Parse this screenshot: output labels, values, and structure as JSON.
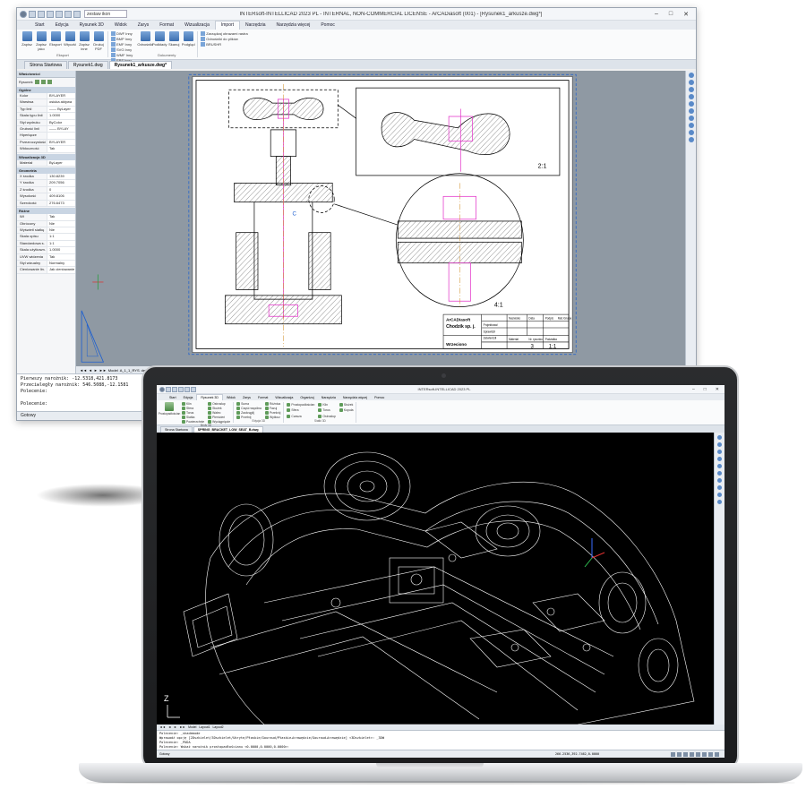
{
  "desktop": {
    "title": "INTERsoft-INTELLICAD 2023 PL - INTERNAL, NON-COMMERCIAL LICENSE - ArCADiasoft (001) - [Rysunek1_arkusze.dwg*]",
    "quick_select": "zestaw ikon",
    "window_controls": {
      "minimize": "–",
      "maximize": "□",
      "close": "✕"
    },
    "menu_tabs": [
      "Start",
      "Edycja",
      "Rysunek 3D",
      "Widok",
      "Zarys",
      "Format",
      "Wizualizacja",
      "Import",
      "Narzędzia",
      "Narzędzia więcej",
      "Pomoc"
    ],
    "active_tab": "Import",
    "ribbon": {
      "group1": {
        "label": "Eksport",
        "buttons": [
          "Zapisz",
          "Zapisz jako",
          "Eksport",
          "Wtyczki",
          "Zapisz inne",
          "Drukuj PDF"
        ],
        "small": [
          "DWF Inny",
          "BMP Inny",
          "EMF Inny",
          "SVG Inny",
          "WMF Inny",
          "EPS Inny"
        ]
      },
      "group2": {
        "label": "Dokumenty",
        "buttons": [
          "Odnośniki",
          "Podkłady",
          "Skanuj",
          "Podgląd"
        ],
        "small": [
          "Zarządzaj obrazami rastra",
          "Odnośniki do plików",
          "BRUSHR"
        ]
      }
    },
    "doc_tabs": [
      "Strona Startowa",
      "Rysunek1.dwg",
      "Rysunek1_arkusze.dwg*"
    ],
    "active_doc": "Rysunek1_arkusze.dwg*",
    "props": {
      "header": "Właściwości",
      "selection": "Rysunek",
      "sections": [
        {
          "title": "Ogólne",
          "rows": [
            [
              "Kolor",
              "BYLAYER"
            ],
            [
              "Warstwa",
              "osiuka aktywa"
            ],
            [
              "Typ linii",
              "—— ByLayer"
            ],
            [
              "Skala typu linii",
              "1.0000"
            ],
            [
              "Styl wydruku",
              "ByColor"
            ],
            [
              "Grubość linii",
              "—— BYLAY"
            ],
            [
              "Hiperłącze",
              ""
            ],
            [
              "Przezroczystość",
              "BYLAYER"
            ],
            [
              "Widoczność",
              "Tak"
            ]
          ]
        },
        {
          "title": "Wizualizacja 3D",
          "rows": [
            [
              "Materiał",
              "ByLayer"
            ]
          ]
        },
        {
          "title": "Geometria",
          "rows": [
            [
              "X środka",
              "130.8239"
            ],
            [
              "Y środka",
              "209.7056"
            ],
            [
              "Z środka",
              "0"
            ],
            [
              "Wysokość",
              "409.8106"
            ],
            [
              "Szerokość",
              "276.6473"
            ]
          ]
        },
        {
          "title": "Różne",
          "rows": [
            [
              "Wł",
              "Tak"
            ],
            [
              "Obrócony",
              "Nie"
            ],
            [
              "Wyświetl siatkę",
              "Nie"
            ],
            [
              "Skala opisu",
              "1:1"
            ],
            [
              "Standardowa s.",
              "1:1"
            ],
            [
              "Skala użytkown.",
              "1.0000"
            ],
            [
              "UVW widzenia",
              "Tak"
            ],
            [
              "Styl wizualny",
              "Normalny"
            ],
            [
              "Cieniowanie lin.",
              "Jak cieniowanie"
            ]
          ]
        }
      ]
    },
    "layout_tabs": [
      "Model",
      "A_1_1_RYS",
      "detal",
      "A_4"
    ],
    "cmd_lines": [
      "Pierwszy narożnik: -12.5318,421.8173",
      "Przeciwległy narożnik: 546.5088,-12.1581",
      "Polecenie:",
      "",
      "Polecenie:"
    ],
    "status_text": "Gotowy",
    "drawing": {
      "title_block": {
        "company": "ArCADiasoft",
        "company_sub": "Chodzik sp. j.",
        "headers": [
          "Nazwisko",
          "Data",
          "Podpis",
          "Mat./Grupa"
        ],
        "rows": [
          "Projektował",
          "Sprawdził",
          "Zatwierdził"
        ],
        "bottom": [
          "Materiał",
          "Nr. rysunku",
          "Podziałka"
        ],
        "drawing_no": "3",
        "scale": "1:1",
        "name": "Wrzeciono"
      },
      "detail1_scale": "2:1",
      "detail2_scale": "4:1",
      "label_c": "C"
    }
  },
  "laptop": {
    "title": "INTERsoft-INTELLICAD 2023 PL",
    "menu_tabs": [
      "Start",
      "Edycja",
      "Rysunek 3D",
      "Widok",
      "Zarys",
      "Format",
      "Wizualizacja",
      "Organizuj",
      "Narzędzia",
      "Narzędzia więcej",
      "Pomoc"
    ],
    "active_tab": "Rysunek 3D",
    "ribbon": {
      "group1": {
        "label": "Bryły 3D",
        "big": "Prostopadłościan",
        "items": [
          "Klin",
          "Ostrosłup",
          "Sfera",
          "Stożek",
          "Torus",
          "Walec",
          "Siatka",
          "Pierścień",
          "Powierzchnie",
          "Wyciągnięcie"
        ]
      },
      "group2": {
        "label": "Edycja 3D",
        "items": [
          "Suma",
          "Różnica",
          "Część wspólna",
          "Fazuj",
          "Zaokrąglij",
          "Przekrój",
          "Przetnij",
          "Wytłocz"
        ]
      },
      "group3": {
        "label": "Siatki 3D",
        "items": [
          "Prostopadłościan",
          "Klin",
          "Stożek",
          "Sfera",
          "Torus",
          "Kopuła",
          "Czasza",
          "Ostrosłup"
        ]
      }
    },
    "doc_tabs": [
      "Strona Startowa",
      "SPRING_BRACKET_LOW_SEAT_B.dwg"
    ],
    "active_doc": "SPRING_BRACKET_LOW_SEAT_B.dwg",
    "layout_tabs": [
      "Model",
      "Layout1",
      "Layout2"
    ],
    "axis_z": "Z",
    "cmd_lines": [
      "Polecenie: _shademode",
      "Wprowadź opcję [2Dszkielet/3Dszkielet/Ukryte/Płaskie/Gouraud/Płaskie+krawędzie/Gouraud+krawędzie] <3Dszkielet>: _3DW",
      "Polecenie: _PUDA",
      "Polecenie: Wskaż narożnik prostopadłościanu <0.0000,0.0000,0.0000>:"
    ],
    "status_text": "Gotowy",
    "coords": "266.2536,392.7462,0.0000"
  }
}
